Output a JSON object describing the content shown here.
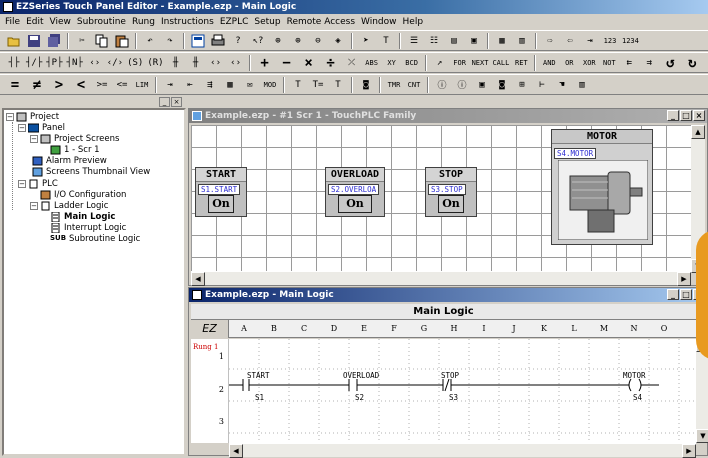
{
  "app": {
    "title": "EZSeries Touch Panel Editor - Example.ezp - Main Logic"
  },
  "menu": [
    "File",
    "Edit",
    "View",
    "Subroutine",
    "Rung",
    "Instructions",
    "EZPLC",
    "Setup",
    "Remote Access",
    "Window",
    "Help"
  ],
  "toolbar2": {
    "labels": [
      "ABS",
      "FOR",
      "NEXT",
      "CALL",
      "AND",
      "OR",
      "XOR",
      "NOT"
    ]
  },
  "toolbar3": {
    "labels": [
      "=",
      "≠",
      ">",
      "<",
      ">=",
      "<=",
      "LIM",
      "TMR",
      "CNT"
    ]
  },
  "tree": {
    "items": [
      "Project",
      "Panel",
      "Project Screens",
      "1 - Scr 1",
      "Alarm Preview",
      "Screens Thumbnail View",
      "PLC",
      "I/O Configuration",
      "Ladder Logic",
      "Main Logic",
      "Interrupt Logic",
      "Subroutine Logic"
    ],
    "selected": "Main Logic"
  },
  "screen_window": {
    "title": "Example.ezp - #1 Scr 1 - TouchPLC Family",
    "tiles": [
      {
        "label": "START",
        "tag": "S1.START",
        "state": "On"
      },
      {
        "label": "OVERLOAD",
        "tag": "S2.OVERLOA",
        "state": "On"
      },
      {
        "label": "STOP",
        "tag": "S3.STOP",
        "state": "On"
      }
    ],
    "motor": {
      "label": "MOTOR",
      "tag": "S4.MOTOR"
    }
  },
  "logic_window": {
    "title": "Example.ezp - Main Logic",
    "header": "Main Logic",
    "corner": "EZ",
    "columns": [
      "A",
      "B",
      "C",
      "D",
      "E",
      "F",
      "G",
      "H",
      "I",
      "J",
      "K",
      "L",
      "M",
      "N",
      "O"
    ],
    "rung_label": "Rung 1",
    "row_numbers": [
      "1",
      "2",
      "3"
    ],
    "contacts": [
      {
        "name": "START",
        "address": "S1"
      },
      {
        "name": "OVERLOAD",
        "address": "S2"
      },
      {
        "name": "STOP",
        "address": "S3"
      }
    ],
    "coil": {
      "name": "MOTOR",
      "address": "S4"
    }
  },
  "colors": {
    "title_active": "#0a246a",
    "tag_text": "#2d2dd0",
    "rung_label": "#cc0000"
  }
}
